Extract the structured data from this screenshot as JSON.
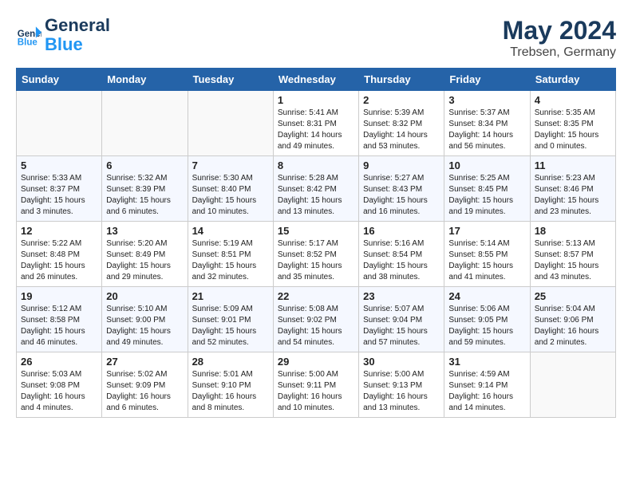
{
  "header": {
    "logo_line1": "General",
    "logo_line2": "Blue",
    "month_year": "May 2024",
    "location": "Trebsen, Germany"
  },
  "days_of_week": [
    "Sunday",
    "Monday",
    "Tuesday",
    "Wednesday",
    "Thursday",
    "Friday",
    "Saturday"
  ],
  "weeks": [
    [
      {
        "day": "",
        "info": ""
      },
      {
        "day": "",
        "info": ""
      },
      {
        "day": "",
        "info": ""
      },
      {
        "day": "1",
        "info": "Sunrise: 5:41 AM\nSunset: 8:31 PM\nDaylight: 14 hours\nand 49 minutes."
      },
      {
        "day": "2",
        "info": "Sunrise: 5:39 AM\nSunset: 8:32 PM\nDaylight: 14 hours\nand 53 minutes."
      },
      {
        "day": "3",
        "info": "Sunrise: 5:37 AM\nSunset: 8:34 PM\nDaylight: 14 hours\nand 56 minutes."
      },
      {
        "day": "4",
        "info": "Sunrise: 5:35 AM\nSunset: 8:35 PM\nDaylight: 15 hours\nand 0 minutes."
      }
    ],
    [
      {
        "day": "5",
        "info": "Sunrise: 5:33 AM\nSunset: 8:37 PM\nDaylight: 15 hours\nand 3 minutes."
      },
      {
        "day": "6",
        "info": "Sunrise: 5:32 AM\nSunset: 8:39 PM\nDaylight: 15 hours\nand 6 minutes."
      },
      {
        "day": "7",
        "info": "Sunrise: 5:30 AM\nSunset: 8:40 PM\nDaylight: 15 hours\nand 10 minutes."
      },
      {
        "day": "8",
        "info": "Sunrise: 5:28 AM\nSunset: 8:42 PM\nDaylight: 15 hours\nand 13 minutes."
      },
      {
        "day": "9",
        "info": "Sunrise: 5:27 AM\nSunset: 8:43 PM\nDaylight: 15 hours\nand 16 minutes."
      },
      {
        "day": "10",
        "info": "Sunrise: 5:25 AM\nSunset: 8:45 PM\nDaylight: 15 hours\nand 19 minutes."
      },
      {
        "day": "11",
        "info": "Sunrise: 5:23 AM\nSunset: 8:46 PM\nDaylight: 15 hours\nand 23 minutes."
      }
    ],
    [
      {
        "day": "12",
        "info": "Sunrise: 5:22 AM\nSunset: 8:48 PM\nDaylight: 15 hours\nand 26 minutes."
      },
      {
        "day": "13",
        "info": "Sunrise: 5:20 AM\nSunset: 8:49 PM\nDaylight: 15 hours\nand 29 minutes."
      },
      {
        "day": "14",
        "info": "Sunrise: 5:19 AM\nSunset: 8:51 PM\nDaylight: 15 hours\nand 32 minutes."
      },
      {
        "day": "15",
        "info": "Sunrise: 5:17 AM\nSunset: 8:52 PM\nDaylight: 15 hours\nand 35 minutes."
      },
      {
        "day": "16",
        "info": "Sunrise: 5:16 AM\nSunset: 8:54 PM\nDaylight: 15 hours\nand 38 minutes."
      },
      {
        "day": "17",
        "info": "Sunrise: 5:14 AM\nSunset: 8:55 PM\nDaylight: 15 hours\nand 41 minutes."
      },
      {
        "day": "18",
        "info": "Sunrise: 5:13 AM\nSunset: 8:57 PM\nDaylight: 15 hours\nand 43 minutes."
      }
    ],
    [
      {
        "day": "19",
        "info": "Sunrise: 5:12 AM\nSunset: 8:58 PM\nDaylight: 15 hours\nand 46 minutes."
      },
      {
        "day": "20",
        "info": "Sunrise: 5:10 AM\nSunset: 9:00 PM\nDaylight: 15 hours\nand 49 minutes."
      },
      {
        "day": "21",
        "info": "Sunrise: 5:09 AM\nSunset: 9:01 PM\nDaylight: 15 hours\nand 52 minutes."
      },
      {
        "day": "22",
        "info": "Sunrise: 5:08 AM\nSunset: 9:02 PM\nDaylight: 15 hours\nand 54 minutes."
      },
      {
        "day": "23",
        "info": "Sunrise: 5:07 AM\nSunset: 9:04 PM\nDaylight: 15 hours\nand 57 minutes."
      },
      {
        "day": "24",
        "info": "Sunrise: 5:06 AM\nSunset: 9:05 PM\nDaylight: 15 hours\nand 59 minutes."
      },
      {
        "day": "25",
        "info": "Sunrise: 5:04 AM\nSunset: 9:06 PM\nDaylight: 16 hours\nand 2 minutes."
      }
    ],
    [
      {
        "day": "26",
        "info": "Sunrise: 5:03 AM\nSunset: 9:08 PM\nDaylight: 16 hours\nand 4 minutes."
      },
      {
        "day": "27",
        "info": "Sunrise: 5:02 AM\nSunset: 9:09 PM\nDaylight: 16 hours\nand 6 minutes."
      },
      {
        "day": "28",
        "info": "Sunrise: 5:01 AM\nSunset: 9:10 PM\nDaylight: 16 hours\nand 8 minutes."
      },
      {
        "day": "29",
        "info": "Sunrise: 5:00 AM\nSunset: 9:11 PM\nDaylight: 16 hours\nand 10 minutes."
      },
      {
        "day": "30",
        "info": "Sunrise: 5:00 AM\nSunset: 9:13 PM\nDaylight: 16 hours\nand 13 minutes."
      },
      {
        "day": "31",
        "info": "Sunrise: 4:59 AM\nSunset: 9:14 PM\nDaylight: 16 hours\nand 14 minutes."
      },
      {
        "day": "",
        "info": ""
      }
    ]
  ]
}
